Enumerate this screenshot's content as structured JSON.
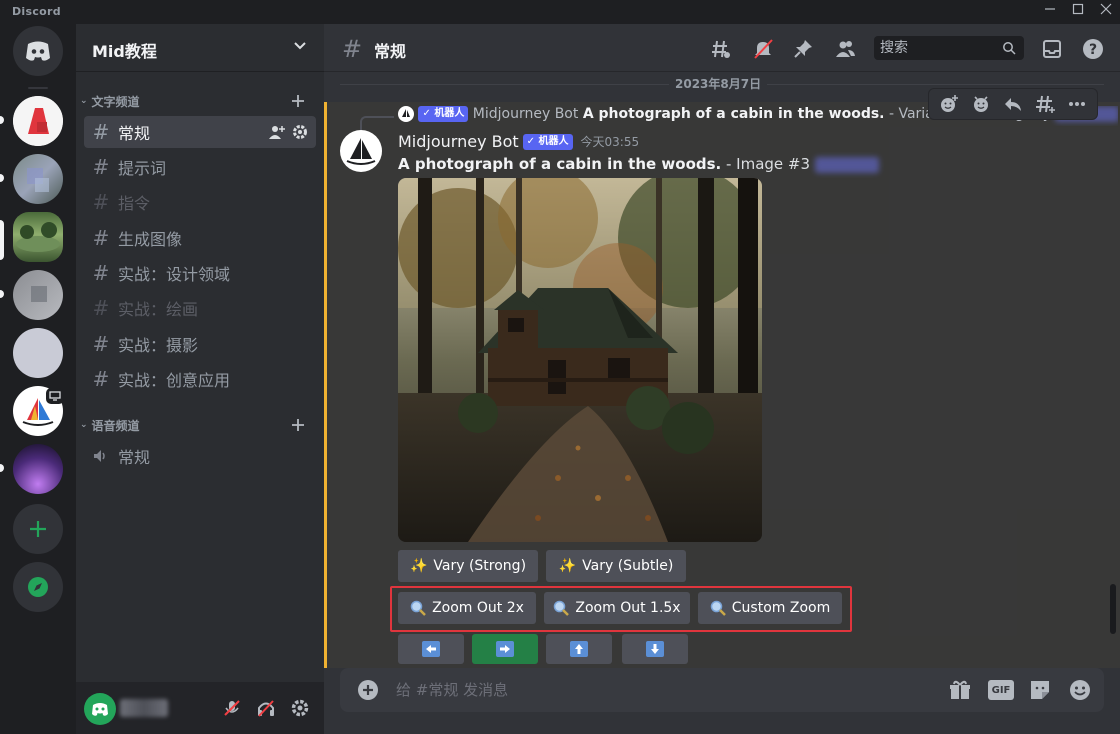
{
  "window": {
    "brand": "Discord",
    "minimize_icon": "minimize-icon",
    "maximize_icon": "maximize-icon",
    "close_icon": "close-icon"
  },
  "servers": [
    {
      "name": "home",
      "icon": "discord-logo-icon"
    },
    {
      "name": "server-red"
    },
    {
      "name": "server-blue-gray"
    },
    {
      "name": "server-green"
    },
    {
      "name": "server-gray"
    },
    {
      "name": "server-light"
    },
    {
      "name": "server-midjourney"
    },
    {
      "name": "server-purple"
    },
    {
      "name": "add-server",
      "icon": "plus-icon"
    },
    {
      "name": "explore",
      "icon": "compass-icon"
    }
  ],
  "guild": {
    "name": "Mid教程"
  },
  "categories": {
    "text": "文字频道",
    "voice": "语音频道"
  },
  "channels": [
    {
      "label": "常规",
      "state": "active"
    },
    {
      "label": "提示词",
      "state": "normal"
    },
    {
      "label": "指令",
      "state": "muted"
    },
    {
      "label": "生成图像",
      "state": "normal"
    },
    {
      "label": "实战：设计领域",
      "state": "normal"
    },
    {
      "label": "实战：绘画",
      "state": "muted"
    },
    {
      "label": "实战：摄影",
      "state": "normal"
    },
    {
      "label": "实战：创意应用",
      "state": "normal"
    }
  ],
  "voice_channels": [
    {
      "label": "常规"
    }
  ],
  "header": {
    "channel": "常规",
    "search_placeholder": "搜索"
  },
  "date_divider": "2023年8月7日",
  "reply": {
    "bot_tag": "✓ 机器人",
    "author": "Midjourney Bot",
    "prompt": "A photograph of a cabin in the woods.",
    "suffix": " - Variations (Strong) by"
  },
  "message": {
    "author": "Midjourney Bot",
    "bot_tag": "✓ 机器人",
    "timestamp": "今天03:55",
    "prompt": "A photograph of a cabin in the woods.",
    "suffix": " - Image #3 "
  },
  "buttons": {
    "vary_strong": "Vary (Strong)",
    "vary_subtle": "Vary (Subtle)",
    "zoom_out_2x": "Zoom Out 2x",
    "zoom_out_1_5x": "Zoom Out 1.5x",
    "custom_zoom": "Custom Zoom"
  },
  "pan_buttons": [
    {
      "name": "pan-left",
      "icon": "arrow-left-icon"
    },
    {
      "name": "pan-right",
      "icon": "arrow-right-icon",
      "active": true
    },
    {
      "name": "pan-up",
      "icon": "arrow-up-icon"
    },
    {
      "name": "pan-down",
      "icon": "arrow-down-icon"
    }
  ],
  "composer": {
    "placeholder": "给 #常规 发消息",
    "gif_label": "GIF"
  },
  "colors": {
    "accent": "#5865f2",
    "highlight": "#f0b232",
    "zoom_outline": "#e0353d",
    "pan_active": "#248046"
  }
}
